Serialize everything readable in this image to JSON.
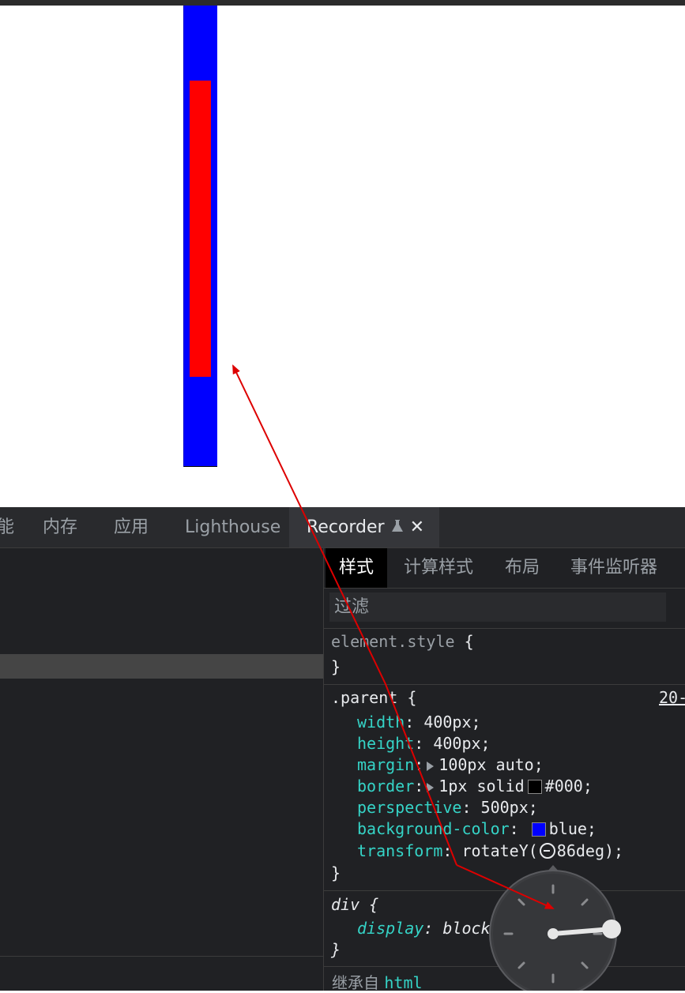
{
  "devtools": {
    "tabs": [
      {
        "label": "能"
      },
      {
        "label": "内存"
      },
      {
        "label": "应用"
      },
      {
        "label": "Lighthouse"
      },
      {
        "label": "Recorder"
      }
    ],
    "subtabs": [
      {
        "label": "样式"
      },
      {
        "label": "计算样式"
      },
      {
        "label": "布局"
      },
      {
        "label": "事件监听器"
      }
    ],
    "filter_placeholder": "过滤",
    "rules": {
      "element_style": {
        "selector": "element.style",
        "open": "{",
        "close": "}"
      },
      "parent": {
        "selector": ".parent",
        "open": "{",
        "close": "}",
        "source": "20-",
        "declarations": [
          {
            "prop": "width",
            "value": "400px;"
          },
          {
            "prop": "height",
            "value": "400px;"
          },
          {
            "prop": "margin",
            "value": "100px auto;"
          },
          {
            "prop": "border",
            "value_pre": "1px solid",
            "value": "#000;"
          },
          {
            "prop": "perspective",
            "value": "500px;"
          },
          {
            "prop": "background-color",
            "value": "blue;"
          },
          {
            "prop": "transform",
            "value_pre": "rotateY(",
            "value": "86deg);"
          }
        ]
      },
      "div": {
        "selector": "div",
        "open": "{",
        "close": "}",
        "declarations": [
          {
            "prop": "display",
            "value": "block"
          }
        ]
      },
      "inherited_label": "继承自",
      "inherited_tag": "html"
    },
    "colon": ":"
  },
  "colors": {
    "parent_bg": "#0000ff",
    "child_bg": "#ff0000",
    "border_swatch": "#000000",
    "bg_swatch": "#0000ff",
    "annotation_arrow": "#dd0000",
    "accent_prop": "#35d4c7"
  },
  "angle_picker": {
    "angle_deg": 86
  }
}
